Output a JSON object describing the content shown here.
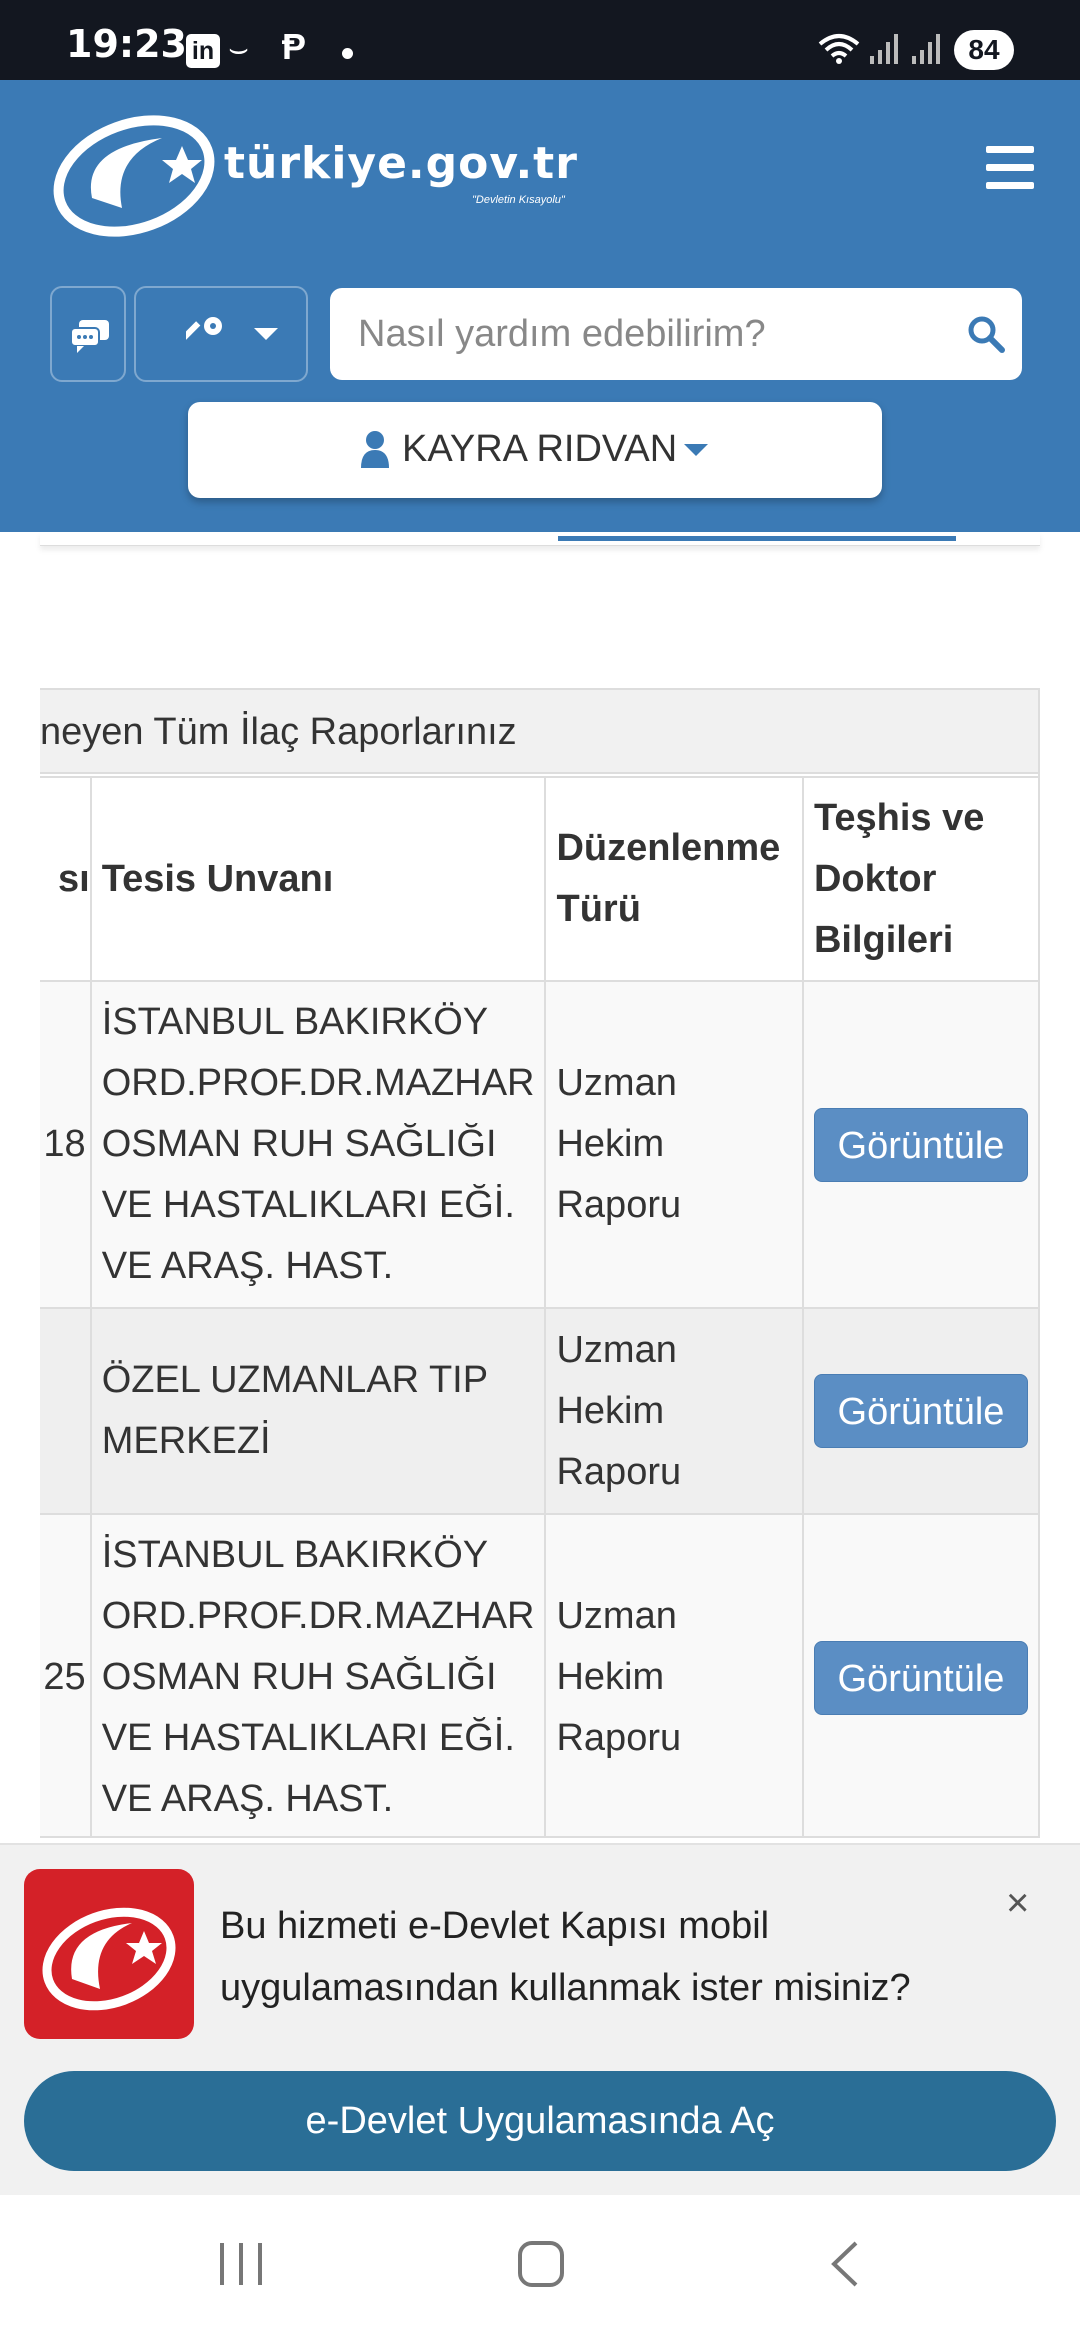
{
  "status_bar": {
    "time": "19:23",
    "app_icons": [
      "linkedin-icon",
      "amazon-icon",
      "p-icon",
      "dot"
    ],
    "battery": "84",
    "wifi_label": "5"
  },
  "header": {
    "logo_text": "türkiye.gov.tr",
    "logo_slogan": "\"Devletin Kısayolu\"",
    "search_placeholder": "Nasıl yardım edebilirim?",
    "user_name": "KAYRA RIDVAN",
    "colors": {
      "primary": "#3b7ab5",
      "button": "#5b8ec4"
    }
  },
  "panel": {
    "heading": "neyen Tüm İlaç Raporlarınız",
    "columns": [
      "sı",
      "Tesis Unvanı",
      "Düzenlenme Türü",
      "Teşhis ve Doktor Bilgileri"
    ],
    "rows": [
      {
        "no_fragment": "18",
        "facility_lines": [
          "İSTANBUL BAKIRKÖY",
          "ORD.PROF.DR.MAZHAR",
          "OSMAN RUH SAĞLIĞI",
          "VE HASTALIKLARI EĞİ.",
          "VE ARAŞ. HAST."
        ],
        "type_lines": [
          "Uzman",
          "Hekim",
          "Raporu"
        ],
        "action": "Görüntüle"
      },
      {
        "no_fragment": "",
        "facility_lines": [
          "ÖZEL UZMANLAR TIP",
          "MERKEZİ"
        ],
        "type_lines": [
          "Uzman",
          "Hekim",
          "Raporu"
        ],
        "action": "Görüntüle"
      },
      {
        "no_fragment": "25",
        "facility_lines": [
          "İSTANBUL BAKIRKÖY",
          "ORD.PROF.DR.MAZHAR",
          "OSMAN RUH SAĞLIĞI",
          "VE HASTALIKLARI EĞİ.",
          "VE ARAŞ. HAST."
        ],
        "type_lines": [
          "Uzman",
          "Hekim",
          "Raporu"
        ],
        "action": "Görüntüle"
      }
    ]
  },
  "banner": {
    "message_line1": "Bu hizmeti e-Devlet Kapısı mobil",
    "message_line2": "uygulamasından kullanmak ister misiniz?",
    "close_symbol": "×",
    "open_button": "e-Devlet Uygulamasında Aç"
  }
}
